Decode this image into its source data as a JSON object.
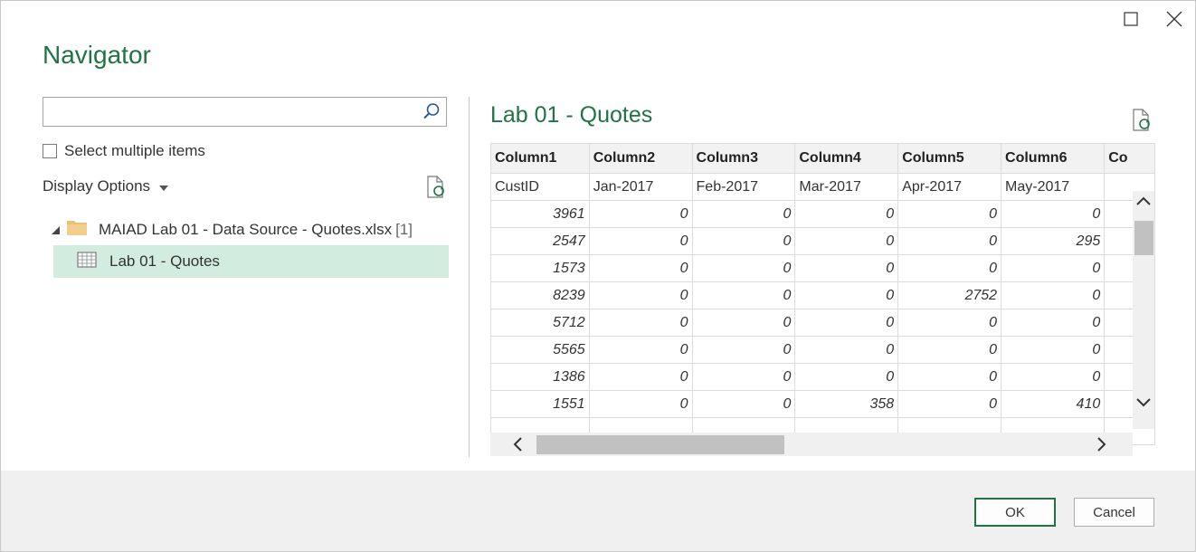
{
  "window": {
    "maximize_icon": "maximize-icon",
    "close_icon": "close-icon"
  },
  "dialog": {
    "title": "Navigator"
  },
  "search": {
    "placeholder": "",
    "value": ""
  },
  "select_multiple": {
    "label": "Select multiple items",
    "checked": false
  },
  "display_options": {
    "label": "Display Options"
  },
  "tree": {
    "parent": {
      "label": "MAIAD Lab 01 - Data Source - Quotes.xlsx",
      "count": "[1]",
      "expanded": true
    },
    "child": {
      "label": "Lab 01 - Quotes",
      "selected": true
    }
  },
  "preview": {
    "title": "Lab 01 - Quotes",
    "columns": [
      "Column1",
      "Column2",
      "Column3",
      "Column4",
      "Column5",
      "Column6",
      "Co"
    ],
    "first_row": [
      "CustID",
      "Jan-2017",
      "Feb-2017",
      "Mar-2017",
      "Apr-2017",
      "May-2017",
      ""
    ],
    "rows": [
      [
        "3961",
        "0",
        "0",
        "0",
        "0",
        "0",
        ""
      ],
      [
        "2547",
        "0",
        "0",
        "0",
        "0",
        "295",
        ""
      ],
      [
        "1573",
        "0",
        "0",
        "0",
        "0",
        "0",
        ""
      ],
      [
        "8239",
        "0",
        "0",
        "0",
        "2752",
        "0",
        ""
      ],
      [
        "5712",
        "0",
        "0",
        "0",
        "0",
        "0",
        ""
      ],
      [
        "5565",
        "0",
        "0",
        "0",
        "0",
        "0",
        ""
      ],
      [
        "1386",
        "0",
        "0",
        "0",
        "0",
        "0",
        ""
      ],
      [
        "1551",
        "0",
        "0",
        "358",
        "0",
        "410",
        ""
      ],
      [
        "",
        "",
        "",
        "",
        "",
        "",
        ""
      ]
    ]
  },
  "footer": {
    "ok_label": "OK",
    "cancel_label": "Cancel"
  },
  "colors": {
    "accent": "#217346",
    "selected_bg": "#d3ece0",
    "footer_bg": "#f0f0f0"
  }
}
